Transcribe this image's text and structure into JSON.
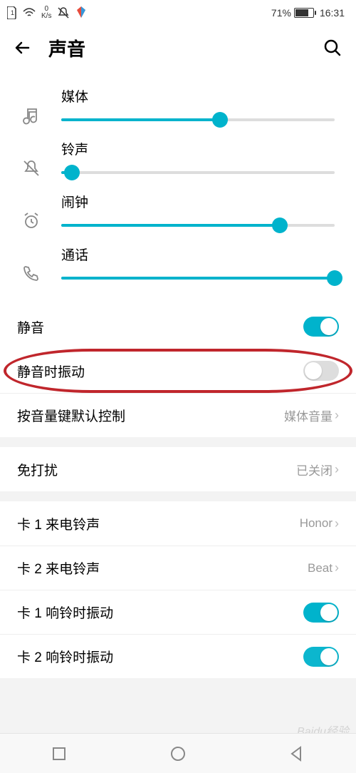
{
  "status": {
    "speed_top": "0",
    "speed_bottom": "K/s",
    "battery_pct": "71%",
    "time": "16:31"
  },
  "header": {
    "title": "声音"
  },
  "sliders": {
    "media": {
      "label": "媒体",
      "value": 58
    },
    "ringtone": {
      "label": "铃声",
      "value": 4
    },
    "alarm": {
      "label": "闹钟",
      "value": 80
    },
    "call": {
      "label": "通话",
      "value": 100
    }
  },
  "items": {
    "mute": {
      "label": "静音",
      "on": true
    },
    "vibrate_mute": {
      "label": "静音时振动",
      "on": false
    },
    "volume_key": {
      "label": "按音量键默认控制",
      "value": "媒体音量"
    },
    "dnd": {
      "label": "免打扰",
      "value": "已关闭"
    },
    "sim1_ring": {
      "label": "卡 1 来电铃声",
      "value": "Honor"
    },
    "sim2_ring": {
      "label": "卡 2 来电铃声",
      "value": "Beat"
    },
    "sim1_vibrate": {
      "label": "卡 1 响铃时振动",
      "on": true
    },
    "sim2_vibrate": {
      "label": "卡 2 响铃时振动",
      "on": true
    }
  },
  "watermark": "Baidu经验"
}
